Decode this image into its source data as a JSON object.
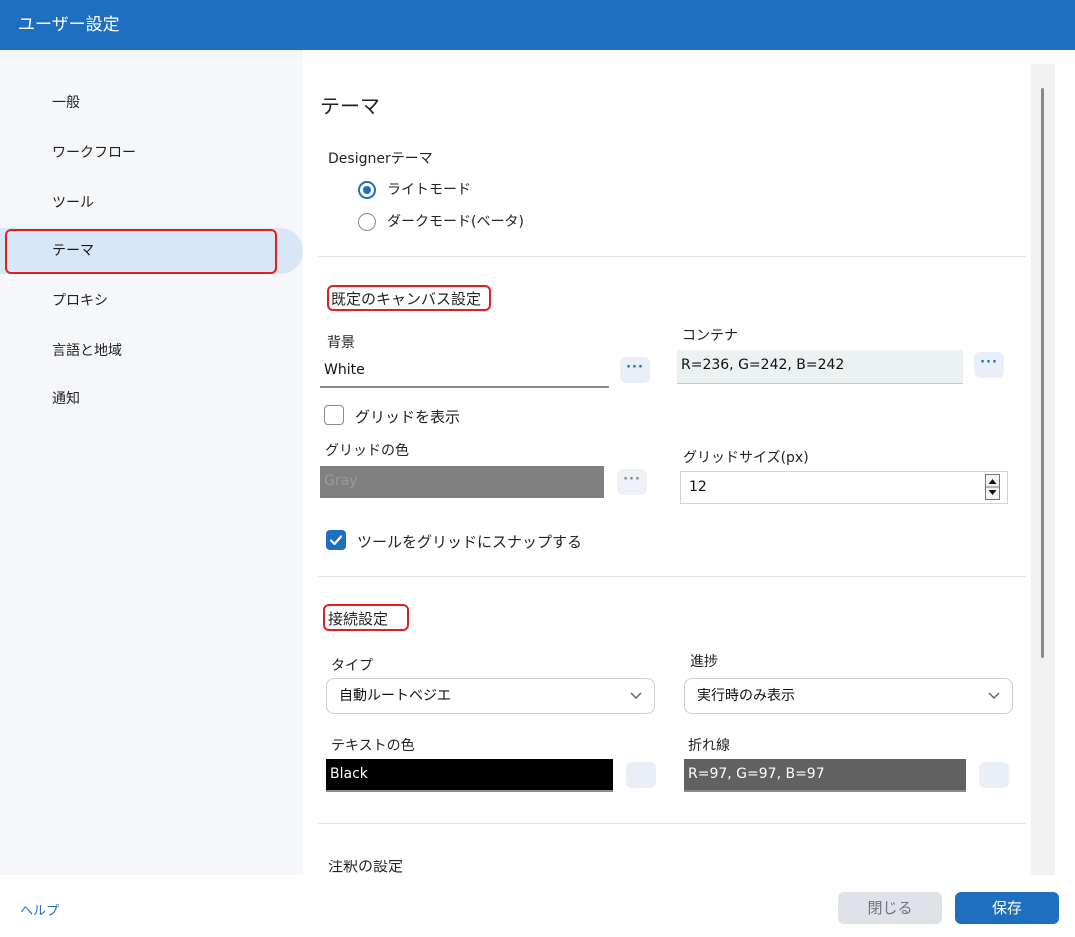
{
  "window": {
    "title": "ユーザー設定"
  },
  "sidebar": {
    "items": [
      {
        "label": "一般"
      },
      {
        "label": "ワークフロー"
      },
      {
        "label": "ツール"
      },
      {
        "label": "テーマ"
      },
      {
        "label": "プロキシ"
      },
      {
        "label": "言語と地域"
      },
      {
        "label": "通知"
      }
    ],
    "active_index": 3
  },
  "main": {
    "page_title": "テーマ",
    "designer_theme": {
      "label": "Designerテーマ",
      "options": [
        "ライトモード",
        "ダークモード(ベータ)"
      ],
      "selected": "ライトモード"
    },
    "canvas": {
      "section_title": "既定のキャンバス設定",
      "background_label": "背景",
      "background_value": "White",
      "container_label": "コンテナ",
      "container_value": "R=236, G=242, B=242",
      "show_grid_label": "グリッドを表示",
      "show_grid_checked": false,
      "grid_color_label": "グリッドの色",
      "grid_color_value": "Gray",
      "grid_size_label": "グリッドサイズ(px)",
      "grid_size_value": "12",
      "snap_label": "ツールをグリッドにスナップする",
      "snap_checked": true,
      "dots": "···"
    },
    "connection": {
      "section_title": "接続設定",
      "type_label": "タイプ",
      "type_value": "自動ルートベジエ",
      "progress_label": "進捗",
      "progress_value": "実行時のみ表示",
      "text_color_label": "テキストの色",
      "text_color_value": "Black",
      "polyline_label": "折れ線",
      "polyline_value": "R=97, G=97, B=97"
    },
    "next_section_title": "注釈の設定"
  },
  "footer": {
    "help_label": "ヘルプ",
    "close_label": "閉じる",
    "save_label": "保存"
  },
  "colors": {
    "accent": "#1f6fc1",
    "container_swatch": "#ECF2F2",
    "grid_swatch": "#808080",
    "text_swatch": "#000000",
    "polyline_swatch": "#616161"
  }
}
